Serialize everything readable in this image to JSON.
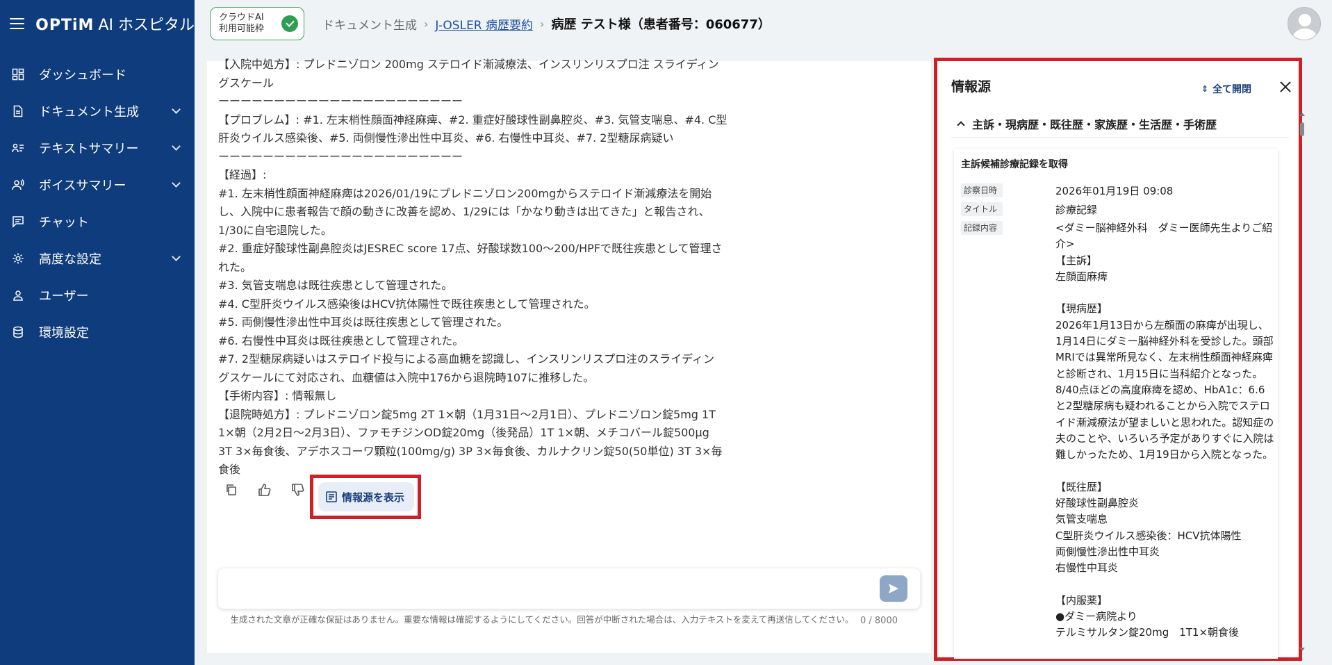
{
  "app": {
    "brand": "OPTiM",
    "name": "AI ホスピタル"
  },
  "sidebar": {
    "items": [
      {
        "label": "ダッシュボード",
        "icon": "dashboard-icon"
      },
      {
        "label": "ドキュメント生成",
        "icon": "document-icon",
        "expandable": true
      },
      {
        "label": "テキストサマリー",
        "icon": "text-summary-icon",
        "expandable": true
      },
      {
        "label": "ボイスサマリー",
        "icon": "voice-summary-icon",
        "expandable": true
      },
      {
        "label": "チャット",
        "icon": "chat-icon"
      },
      {
        "label": "高度な設定",
        "icon": "gear-icon",
        "expandable": true
      },
      {
        "label": "ユーザー",
        "icon": "user-icon"
      },
      {
        "label": "環境設定",
        "icon": "database-icon"
      }
    ]
  },
  "header": {
    "ai_badge": "クラウドAI\n利用可能枠",
    "breadcrumb": {
      "root": "ドキュメント生成",
      "link": "J-OSLER 病歴要約",
      "current": "病歴 テスト様（患者番号：060677）"
    }
  },
  "document": {
    "lines": [
      "【入院中処方】: プレドニゾロン 200mg ステロイド漸減療法、インスリンリスプロ注 スライディン",
      "グスケール",
      "ーーーーーーーーーーーーーーーーーーーーーー",
      "【プロブレム】: #1. 左末梢性顔面神経麻痺、#2. 重症好酸球性副鼻腔炎、#3. 気管支喘息、#4. C型",
      "肝炎ウイルス感染後、#5. 両側慢性滲出性中耳炎、#6. 右慢性中耳炎、#7. 2型糖尿病疑い",
      "ーーーーーーーーーーーーーーーーーーーーーー",
      "【経過】:",
      "#1. 左末梢性顔面神経麻痺は2026/01/19にプレドニゾロン200mgからステロイド漸減療法を開始",
      "し、入院中に患者報告で顔の動きに改善を認め、1/29には「かなり動きは出てきた」と報告され、",
      "1/30に自宅退院した。",
      "#2. 重症好酸球性副鼻腔炎はJESREC score 17点、好酸球数100〜200/HPFで既往疾患として管理さ",
      "れた。",
      "#3. 気管支喘息は既往疾患として管理された。",
      "#4. C型肝炎ウイルス感染後はHCV抗体陽性で既往疾患として管理された。",
      "#5. 両側慢性滲出性中耳炎は既往疾患として管理された。",
      "#6. 右慢性中耳炎は既往疾患として管理された。",
      "#7. 2型糖尿病疑いはステロイド投与による高血糖を認識し、インスリンリスプロ注のスライディン",
      "グスケールにて対応され、血糖値は入院中176から退院時107に推移した。",
      "【手術内容】: 情報無し",
      "【退院時処方】: プレドニゾロン錠5mg 2T 1×朝（1月31日〜2月1日）、プレドニゾロン錠5mg 1T",
      "1×朝（2月2日〜2月3日）、ファモチジンOD錠20mg（後発品）1T 1×朝、メチコバール錠500μg",
      "3T 3×毎食後、アデホスコーワ顆粒(100mg/g) 3P 3×毎食後、カルナクリン錠50(50単位) 3T 3×毎",
      "食後"
    ],
    "show_source_label": "情報源を表示"
  },
  "input": {
    "placeholder": "",
    "value": "",
    "disclaimer": "生成された文章が正確な保証はありません。重要な情報は確認するようにしてください。回答が中断された場合は、入力テキストを変えて再送信してください。",
    "counter": "0 / 8000"
  },
  "panel": {
    "title": "情報源",
    "expand_all": "全て開閉",
    "section_title": "主訴・現病歴・既往歴・家族歴・生活歴・手術歴",
    "card": {
      "title": "主訴候補診療記録を取得",
      "fields": [
        {
          "key": "診察日時",
          "value": "2026年01月19日 09:08"
        },
        {
          "key": "タイトル",
          "value": "診療記録"
        },
        {
          "key": "記録内容",
          "value": ""
        }
      ],
      "content": "<ダミー脳神経外科　ダミー医師先生よりご紹介>\n【主訴】\n左顔面麻痺\n\n【現病歴】\n2026年1月13日から左顔面の麻痺が出現し、1月14日にダミー脳神経外科を受診した。頭部MRIでは異常所見なく、左末梢性顔面神経麻痺と診断され、1月15日に当科紹介となった。8/40点ほどの高度麻痺を認め、HbA1c：6.6と2型糖尿病も疑われることから入院でステロイド漸減療法が望ましいと思われた。認知症の夫のことや、いろいろ予定がありすぐに入院は難しかったため、1月19日から入院となった。\n\n【既往歴】\n好酸球性副鼻腔炎\n気管支喘息\nC型肝炎ウイルス感染後：HCV抗体陽性\n両側慢性滲出性中耳炎\n右慢性中耳炎\n\n【内服薬】\n●ダミー病院より\nテルミサルタン錠20mg　1T1×朝食後"
    }
  },
  "colors": {
    "sidebar": "#0f3c7d",
    "accent": "#1a4f9c",
    "highlight": "#d02027",
    "badge_green": "#2e9e55"
  }
}
